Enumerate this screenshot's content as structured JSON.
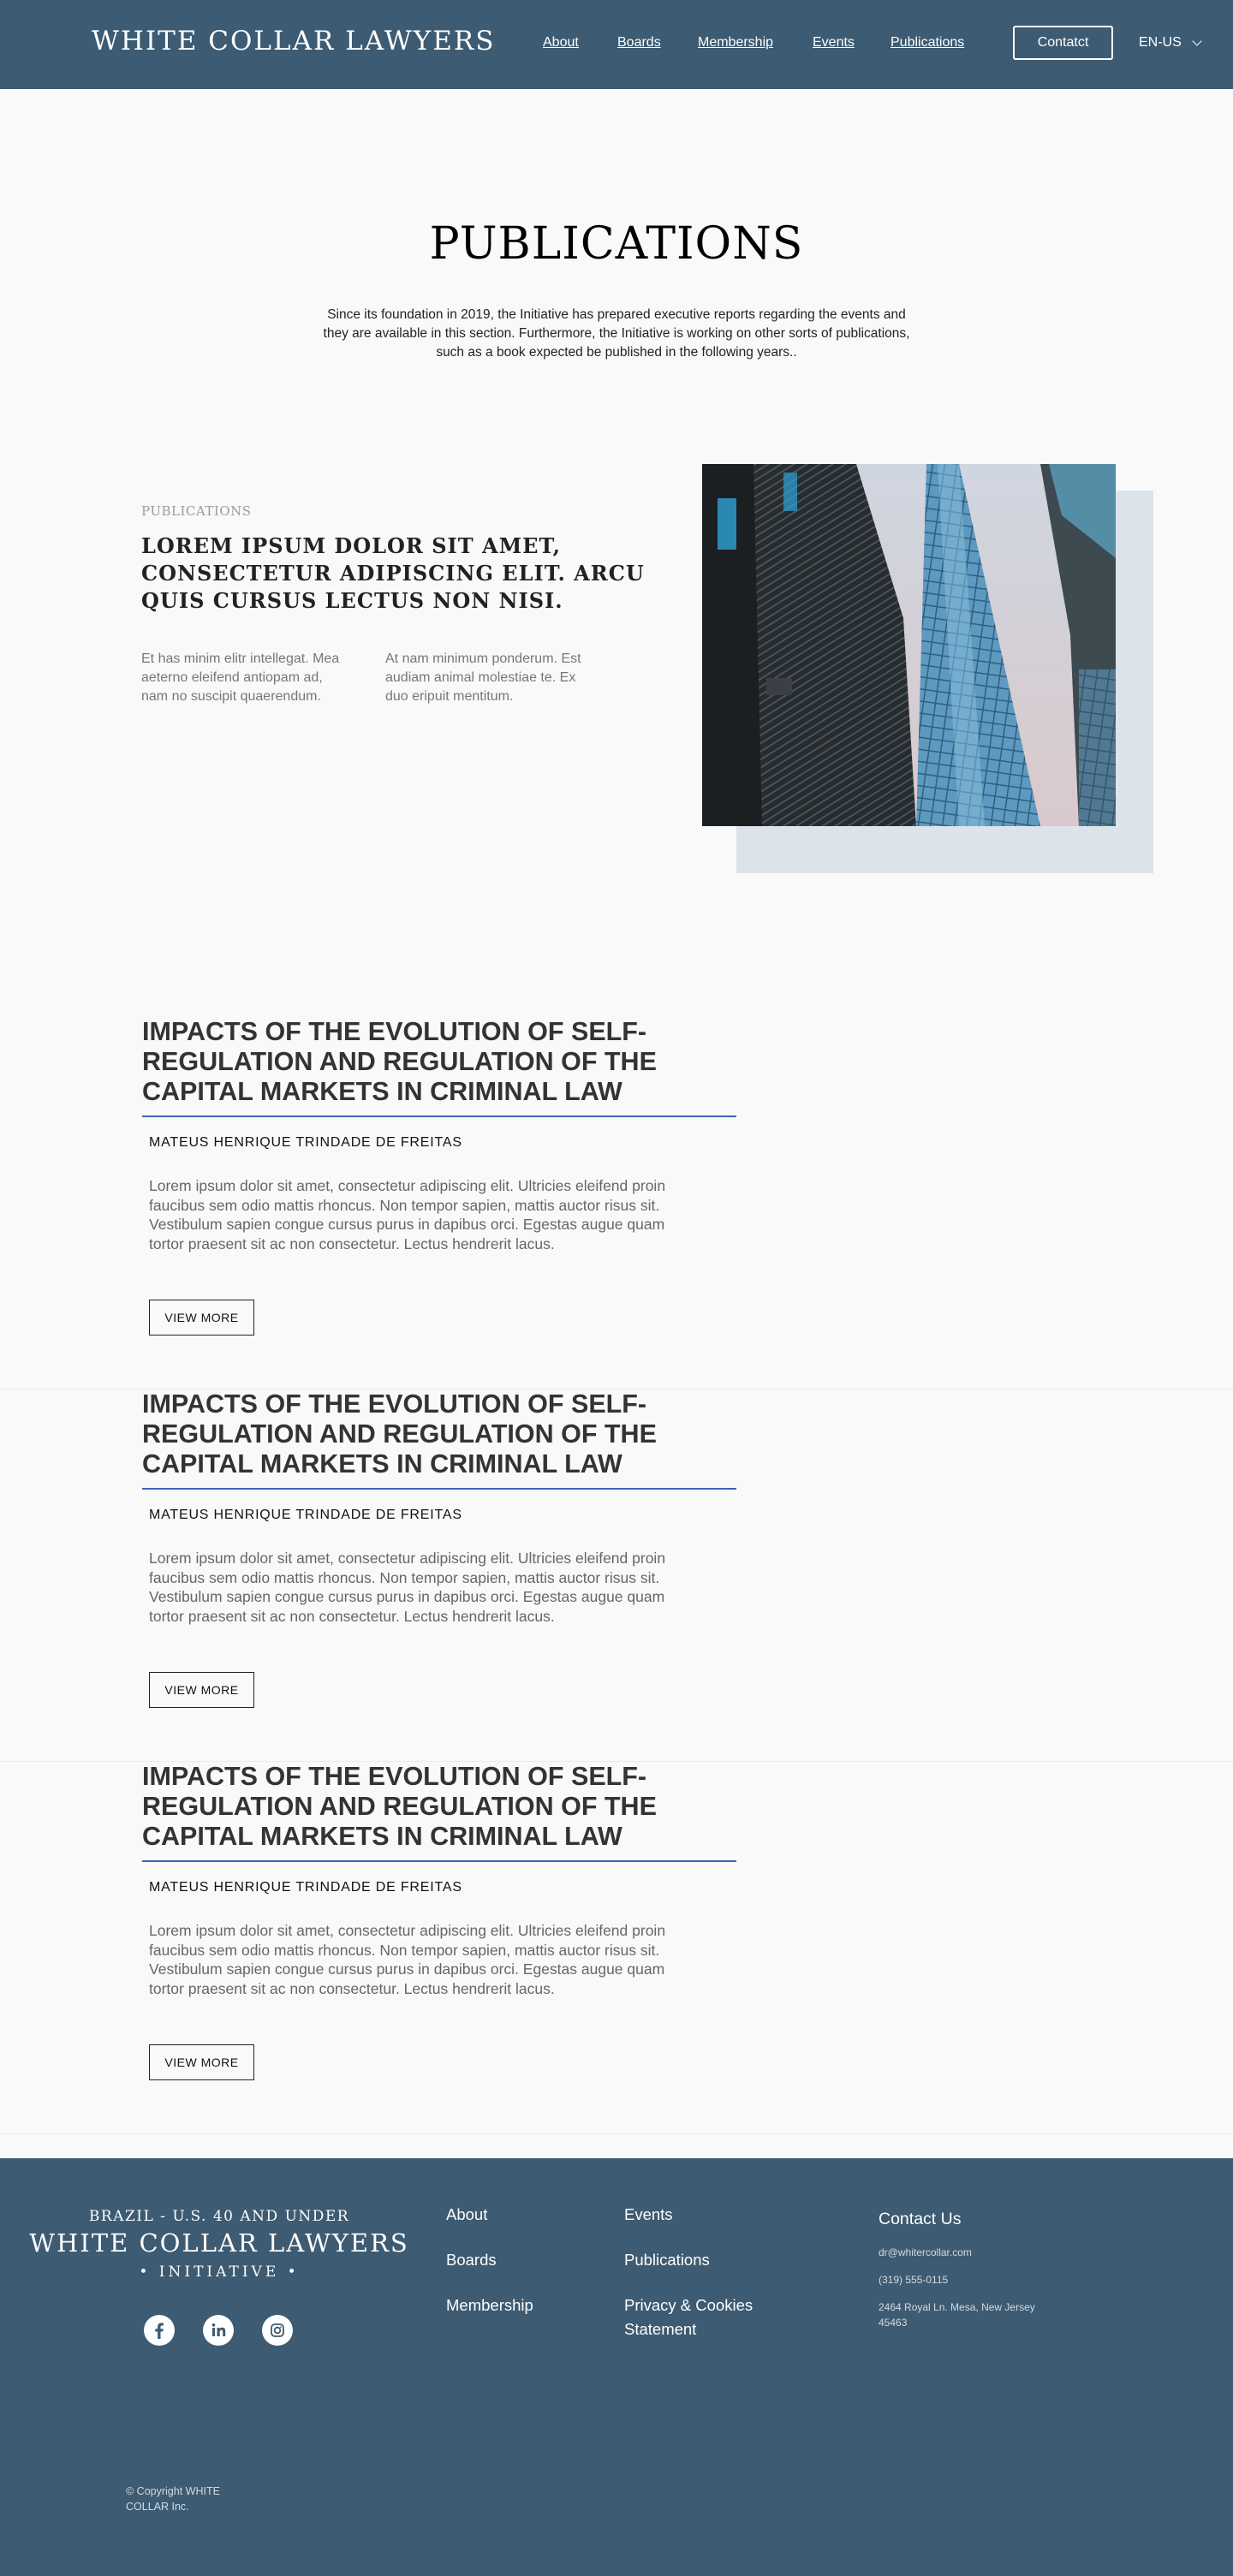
{
  "header": {
    "logo": "WHITE COLLAR LAWYERS",
    "nav": [
      "About",
      "Boards",
      "Membership",
      "Events",
      "Publications"
    ],
    "contact_label": "Contatct",
    "language": "EN-US"
  },
  "hero": {
    "title": "PUBLICATIONS",
    "intro": "Since its foundation in 2019, the Initiative has prepared executive reports regarding the events and they are available in this section. Furthermore, the Initiative is working on other sorts of publications, such as a book expected be published in the following years.."
  },
  "feature": {
    "eyebrow": "PUBLICATIONS",
    "heading": "LOREM IPSUM DOLOR SIT AMET, CONSECTETUR ADIPISCING ELIT. ARCU QUIS CURSUS LECTUS NON NISI.",
    "col1": "Et has minim elitr intellegat. Mea aeterno eleifend antiopam ad, nam no suscipit quaerendum.",
    "col2": "At nam minimum ponderum. Est audiam animal molestiae te. Ex duo eripuit mentitum."
  },
  "publications": [
    {
      "title": "IMPACTS OF THE EVOLUTION OF SELF-REGULATION AND REGULATION OF THE CAPITAL MARKETS IN CRIMINAL LAW",
      "author": "MATEUS HENRIQUE TRINDADE DE FREITAS",
      "body": "Lorem ipsum dolor sit amet, consectetur adipiscing elit. Ultricies eleifend proin faucibus sem odio mattis rhoncus. Non tempor sapien, mattis auctor risus sit. Vestibulum sapien congue cursus purus in dapibus orci. Egestas augue quam tortor praesent sit ac non consectetur. Lectus hendrerit lacus.",
      "button": "VIEW MORE"
    },
    {
      "title": "IMPACTS OF THE EVOLUTION OF SELF-REGULATION AND REGULATION OF THE CAPITAL MARKETS IN CRIMINAL LAW",
      "author": "MATEUS HENRIQUE TRINDADE DE FREITAS",
      "body": "Lorem ipsum dolor sit amet, consectetur adipiscing elit. Ultricies eleifend proin faucibus sem odio mattis rhoncus. Non tempor sapien, mattis auctor risus sit. Vestibulum sapien congue cursus purus in dapibus orci. Egestas augue quam tortor praesent sit ac non consectetur. Lectus hendrerit lacus.",
      "button": "VIEW MORE"
    },
    {
      "title": "IMPACTS OF THE EVOLUTION OF SELF-REGULATION AND REGULATION OF THE CAPITAL MARKETS IN CRIMINAL LAW",
      "author": "MATEUS HENRIQUE TRINDADE DE FREITAS",
      "body": "Lorem ipsum dolor sit amet, consectetur adipiscing elit. Ultricies eleifend proin faucibus sem odio mattis rhoncus. Non tempor sapien, mattis auctor risus sit. Vestibulum sapien congue cursus purus in dapibus orci. Egestas augue quam tortor praesent sit ac non consectetur. Lectus hendrerit lacus.",
      "button": "VIEW MORE"
    }
  ],
  "footer": {
    "sub1": "BRAZIL - U.S. 40 AND UNDER",
    "logo": "WHITE COLLAR LAWYERS",
    "sub2": "• INITIATIVE •",
    "social_icons": [
      "facebook-icon",
      "linkedin-icon",
      "instagram-icon"
    ],
    "links_col1": [
      "About",
      "Boards",
      "Membership"
    ],
    "links_col2": [
      "Events",
      "Publications",
      "Privacy & Cookies Statement"
    ],
    "contact_title": "Contact Us",
    "email": "dr@whitercollar.com",
    "phone": "(319) 555-0115",
    "address": "2464 Royal Ln. Mesa, New Jersey 45463",
    "copyright": "© Copyright WHITE COLLAR Inc."
  },
  "colors": {
    "brand": "#3d5b72",
    "accent_rule": "#3f62b8",
    "image_backdrop": "#dce3ea",
    "page_bg": "#f9f9f9"
  }
}
